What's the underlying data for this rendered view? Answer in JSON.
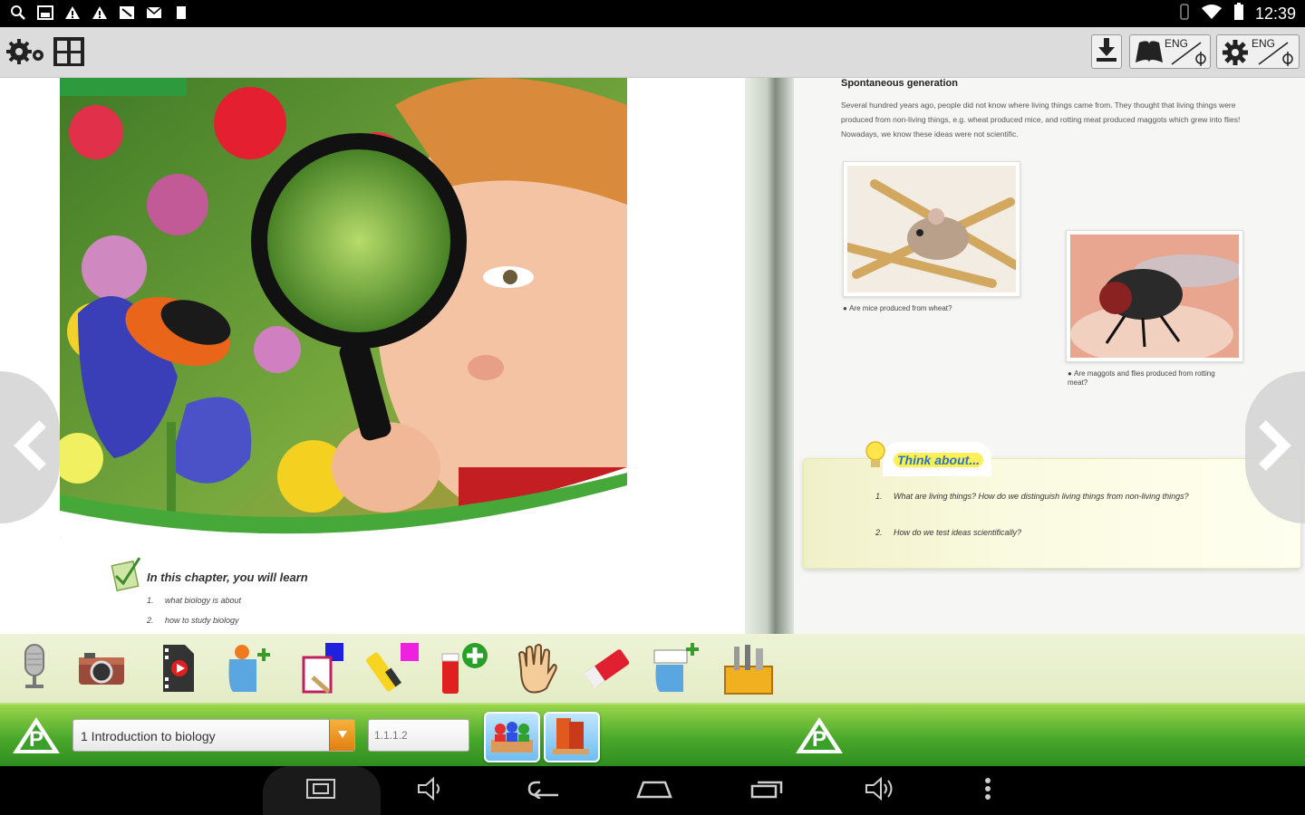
{
  "status_bar": {
    "time": "12:39",
    "left_icons": [
      "search-icon",
      "gallery-icon",
      "warning-icon",
      "warning-icon",
      "data-icon",
      "mail-icon",
      "sd-card-icon"
    ],
    "right_icons": [
      "vibrate-icon",
      "wifi-icon",
      "battery-icon"
    ]
  },
  "app_toolbar": {
    "left_icons": [
      "settings-icon",
      "grid-view-icon"
    ],
    "right_buttons": [
      {
        "name": "download-button",
        "icon": "download-icon"
      },
      {
        "name": "book-language-button",
        "icon": "book-icon",
        "label": "ENG"
      },
      {
        "name": "settings-language-button",
        "icon": "gear-icon",
        "label": "ENG"
      }
    ]
  },
  "left_page": {
    "learn_title": "In this chapter, you will learn",
    "items": [
      {
        "num": "1.",
        "text": "what biology is about"
      },
      {
        "num": "2.",
        "text": "how to study biology"
      }
    ]
  },
  "right_page": {
    "title": "Spontaneous generation",
    "paragraph": "Several hundred years ago, people did not know where living things came from. They thought that living things were produced from non-living things, e.g. wheat produced mice, and rotting meat produced maggots which grew into flies! Nowadays, we know these ideas were not scientific.",
    "caption_mouse": "Are mice produced from wheat?",
    "caption_fly": "Are maggots and flies produced from rotting meat?",
    "think_label": "Think about...",
    "questions": [
      {
        "num": "1.",
        "text": "What are living things? How do we distinguish living things from non-living things?"
      },
      {
        "num": "2.",
        "text": "How do we test ideas scientifically?"
      }
    ]
  },
  "tools": [
    "microphone-tool",
    "camera-tool",
    "video-tool",
    "add-note-tool",
    "edit-tool",
    "highlighter-tool",
    "add-pen-tool",
    "hand-tool",
    "eraser-tool",
    "add-text-tool",
    "toolbox-tool"
  ],
  "chapter_bar": {
    "chapter": "1 Introduction to biology",
    "page_placeholder": "1.1.1.2",
    "buttons": [
      "class-view-button",
      "book-view-button"
    ]
  },
  "colors": {
    "toolbar_bg": "#dcdcdc",
    "chapter_green": "#4aa82c",
    "tool_bg": "#e3ecc6",
    "accent_orange": "#e27d12",
    "think_blue": "#2d6fd6"
  }
}
